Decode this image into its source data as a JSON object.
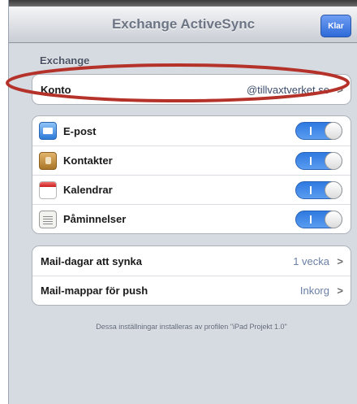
{
  "navbar": {
    "title": "Exchange ActiveSync",
    "done_label": "Klar"
  },
  "exchange_section": {
    "header": "Exchange",
    "account_label": "Konto",
    "account_value": "@tillvaxtverket.se"
  },
  "services": [
    {
      "label": "E-post",
      "icon": "mail-icon",
      "enabled": true
    },
    {
      "label": "Kontakter",
      "icon": "contacts-icon",
      "enabled": true
    },
    {
      "label": "Kalendrar",
      "icon": "calendar-icon",
      "enabled": true
    },
    {
      "label": "Påminnelser",
      "icon": "reminders-icon",
      "enabled": true
    }
  ],
  "sync_settings": [
    {
      "label": "Mail-dagar att synka",
      "value": "1 vecka"
    },
    {
      "label": "Mail-mappar för push",
      "value": "Inkorg"
    }
  ],
  "footer": "Dessa inställningar installeras av profilen \"iPad Projekt 1.0\"",
  "colors": {
    "toggle_on": "#2f79e0",
    "value_text": "#6a7fa6",
    "annotation": "#b5322a"
  },
  "chevron": ">"
}
